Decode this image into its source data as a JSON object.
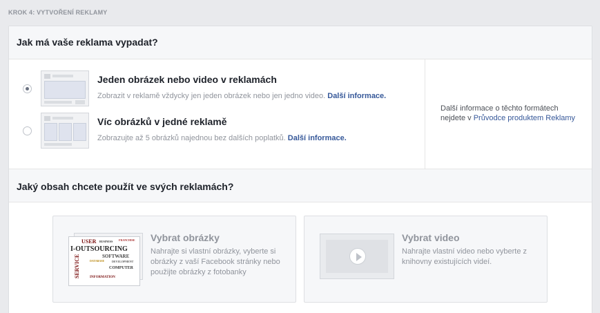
{
  "step": {
    "label": "KROK 4: VYTVOŘENÍ REKLAMY"
  },
  "format_section": {
    "title": "Jak má vaše reklama vypadat?",
    "options": [
      {
        "title": "Jeden obrázek nebo video v reklamách",
        "description": "Zobrazit v reklamě vždycky jen jeden obrázek nebo jen jedno video.",
        "link": "Další informace.",
        "selected": true
      },
      {
        "title": "Víc obrázků v jedné reklamě",
        "description": "Zobrazujte až 5 obrázků najednou bez dalších poplatků.",
        "link": "Další informace.",
        "selected": false
      }
    ],
    "side_info": {
      "text_line1": "Další informace o těchto formátech",
      "text_prefix": "nejdete v",
      "link": "Průvodce produktem Reklamy"
    }
  },
  "content_section": {
    "title": "Jaký obsah chcete použít ve svých reklamách?",
    "images_card": {
      "title": "Vybrat obrázky",
      "description": "Nahrajte si vlastní obrázky, vyberte si obrázky z vaší Facebook stránky nebo použijte obrázky z fotobanky",
      "thumbnail_words": [
        "USER",
        "BUSINESS",
        "FRANCHISE",
        "I-OUTSOURCING",
        "SOFTWARE",
        "DATABASE",
        "SERVICE",
        "COMPUTER",
        "INFORMATION",
        "DEVELOPMENT"
      ]
    },
    "video_card": {
      "title": "Vybrat video",
      "description": "Nahrajte vlastní video nebo vyberte z knihovny existujících videí."
    }
  },
  "colors": {
    "page_bg": "#e9eaed",
    "link": "#365899",
    "muted": "#90949c"
  }
}
